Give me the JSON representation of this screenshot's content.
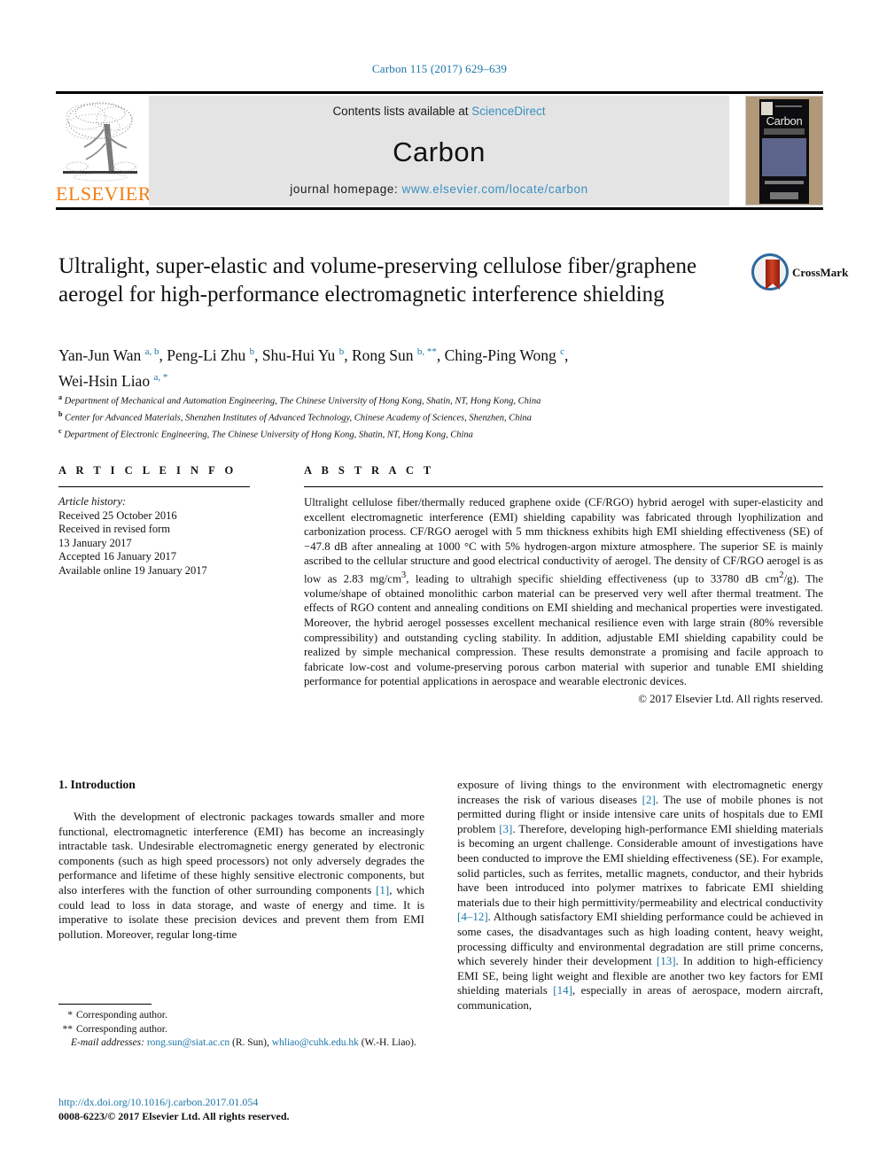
{
  "running_head": "Carbon 115 (2017) 629–639",
  "banner": {
    "contents_prefix": "Contents lists available at ",
    "sciencedirect": "ScienceDirect",
    "journal_title": "Carbon",
    "homepage_label": "journal homepage: ",
    "homepage_url": "www.elsevier.com/locate/carbon",
    "publisher_logo_text": "ELSEVIER",
    "cover_title": "Carbon",
    "link_color": "#3a8fbf",
    "publisher_color": "#f07e13"
  },
  "article": {
    "title": "Ultralight, super-elastic and volume-preserving cellulose fiber/graphene aerogel for high-performance electromagnetic interference shielding",
    "crossmark_label": "CrossMark",
    "authors_line_1_parts": [
      {
        "name": "Yan-Jun Wan ",
        "sup": "a, b"
      },
      {
        "name": ", Peng-Li Zhu ",
        "sup": "b"
      },
      {
        "name": ", Shu-Hui Yu ",
        "sup": "b"
      },
      {
        "name": ", Rong Sun ",
        "sup": "b, **"
      },
      {
        "name": ", Ching-Ping Wong ",
        "sup": "c"
      }
    ],
    "authors_line_1_tail": ",",
    "authors_line_2_parts": [
      {
        "name": "Wei-Hsin Liao ",
        "sup": "a, *"
      }
    ],
    "affiliations": [
      {
        "marker": "a",
        "text": "Department of Mechanical and Automation Engineering, The Chinese University of Hong Kong, Shatin, NT, Hong Kong, China"
      },
      {
        "marker": "b",
        "text": "Center for Advanced Materials, Shenzhen Institutes of Advanced Technology, Chinese Academy of Sciences, Shenzhen, China"
      },
      {
        "marker": "c",
        "text": "Department of Electronic Engineering, The Chinese University of Hong Kong, Shatin, NT, Hong Kong, China"
      }
    ]
  },
  "article_info": {
    "heading": "A R T I C L E   I N F O",
    "history_label": "Article history:",
    "history_lines": [
      "Received 25 October 2016",
      "Received in revised form",
      "13 January 2017",
      "Accepted 16 January 2017",
      "Available online 19 January 2017"
    ]
  },
  "abstract": {
    "heading": "A B S T R A C T",
    "text": "Ultralight cellulose fiber/thermally reduced graphene oxide (CF/RGO) hybrid aerogel with super-elasticity and excellent electromagnetic interference (EMI) shielding capability was fabricated through lyophilization and carbonization process. CF/RGO aerogel with 5 mm thickness exhibits high EMI shielding effectiveness (SE) of -47.8 dB after annealing at 1000 °C with 5% hydrogen-argon mixture atmosphere. The superior SE is mainly ascribed to the cellular structure and good electrical conductivity of aerogel. The density of CF/RGO aerogel is as low as 2.83 mg/cm3, leading to ultrahigh specific shielding effectiveness (up to 33780 dB cm2/g). The volume/shape of obtained monolithic carbon material can be preserved very well after thermal treatment. The effects of RGO content and annealing conditions on EMI shielding and mechanical properties were investigated. Moreover, the hybrid aerogel possesses excellent mechanical resilience even with large strain (80% reversible compressibility) and outstanding cycling stability. In addition, adjustable EMI shielding capability could be realized by simple mechanical compression. These results demonstrate a promising and facile approach to fabricate low-cost and volume-preserving porous carbon material with superior and tunable EMI shielding performance for potential applications in aerospace and wearable electronic devices.",
    "copyright": "© 2017 Elsevier Ltd. All rights reserved."
  },
  "body": {
    "section_heading": "1. Introduction",
    "left_paragraph": "With the development of electronic packages towards smaller and more functional, electromagnetic interference (EMI) has become an increasingly intractable task. Undesirable electromagnetic energy generated by electronic components (such as high speed processors) not only adversely degrades the performance and lifetime of these highly sensitive electronic components, but also interferes with the function of other surrounding components [1], which could lead to loss in data storage, and waste of energy and time. It is imperative to isolate these precision devices and prevent them from EMI pollution. Moreover, regular long-time",
    "right_paragraph": "exposure of living things to the environment with electromagnetic energy increases the risk of various diseases [2]. The use of mobile phones is not permitted during flight or inside intensive care units of hospitals due to EMI problem [3]. Therefore, developing high-performance EMI shielding materials is becoming an urgent challenge. Considerable amount of investigations have been conducted to improve the EMI shielding effectiveness (SE). For example, solid particles, such as ferrites, metallic magnets, conductor, and their hybrids have been introduced into polymer matrixes to fabricate EMI shielding materials due to their high permittivity/permeability and electrical conductivity [4–12]. Although satisfactory EMI shielding performance could be achieved in some cases, the disadvantages such as high loading content, heavy weight, processing difficulty and environmental degradation are still prime concerns, which severely hinder their development [13]. In addition to high-efficiency EMI SE, being light weight and flexible are another two key factors for EMI shielding materials [14], especially in areas of aerospace, modern aircraft, communication,"
  },
  "footnotes": {
    "corresponding_1_marker": "*",
    "corresponding_1": "Corresponding author.",
    "corresponding_2_marker": "**",
    "corresponding_2": "Corresponding author.",
    "email_label": "E-mail addresses:",
    "email_1": "rong.sun@siat.ac.cn",
    "email_1_owner": "(R. Sun)",
    "email_2": "whliao@cuhk.edu.hk",
    "email_2_owner": "(W.-H. Liao)."
  },
  "doi_block": {
    "doi": "http://dx.doi.org/10.1016/j.carbon.2017.01.054",
    "issn_line": "0008-6223/© 2017 Elsevier Ltd. All rights reserved."
  }
}
